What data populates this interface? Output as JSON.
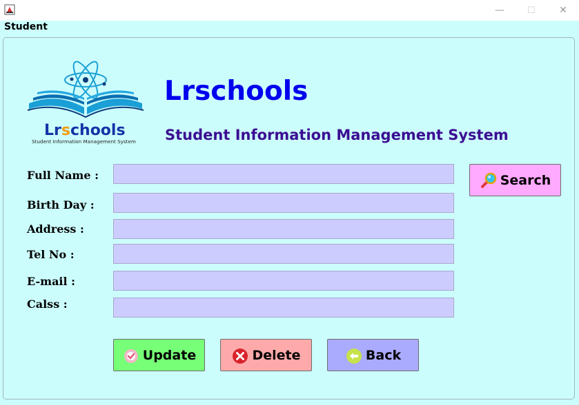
{
  "window": {
    "title": "",
    "minimize": "—",
    "maximize": "☐",
    "close": "✕"
  },
  "menu": {
    "label": "Student"
  },
  "logo": {
    "brand_prefix": "Lr",
    "brand_s": "s",
    "brand_suffix": "chools",
    "tagline": "Student Information Management System"
  },
  "header": {
    "title": "Lrschools",
    "subtitle": "Student Information Management System"
  },
  "form": {
    "fields": [
      {
        "label": "Full Name :",
        "value": ""
      },
      {
        "label": "Birth Day :",
        "value": ""
      },
      {
        "label": "Address :",
        "value": ""
      },
      {
        "label": "Tel No :",
        "value": ""
      },
      {
        "label": "E-mail :",
        "value": ""
      },
      {
        "label": "Calss :",
        "value": ""
      }
    ]
  },
  "buttons": {
    "search": {
      "label": "Search",
      "color": "#ffaaff"
    },
    "update": {
      "label": "Update",
      "color": "#77ff77"
    },
    "delete": {
      "label": "Delete",
      "color": "#ffaaaa"
    },
    "back": {
      "label": "Back",
      "color": "#aaaaff"
    }
  },
  "colors": {
    "background": "#ccfdfd",
    "field": "#ccccff",
    "title": "#0000ee",
    "subtitle": "#3b0e92"
  }
}
